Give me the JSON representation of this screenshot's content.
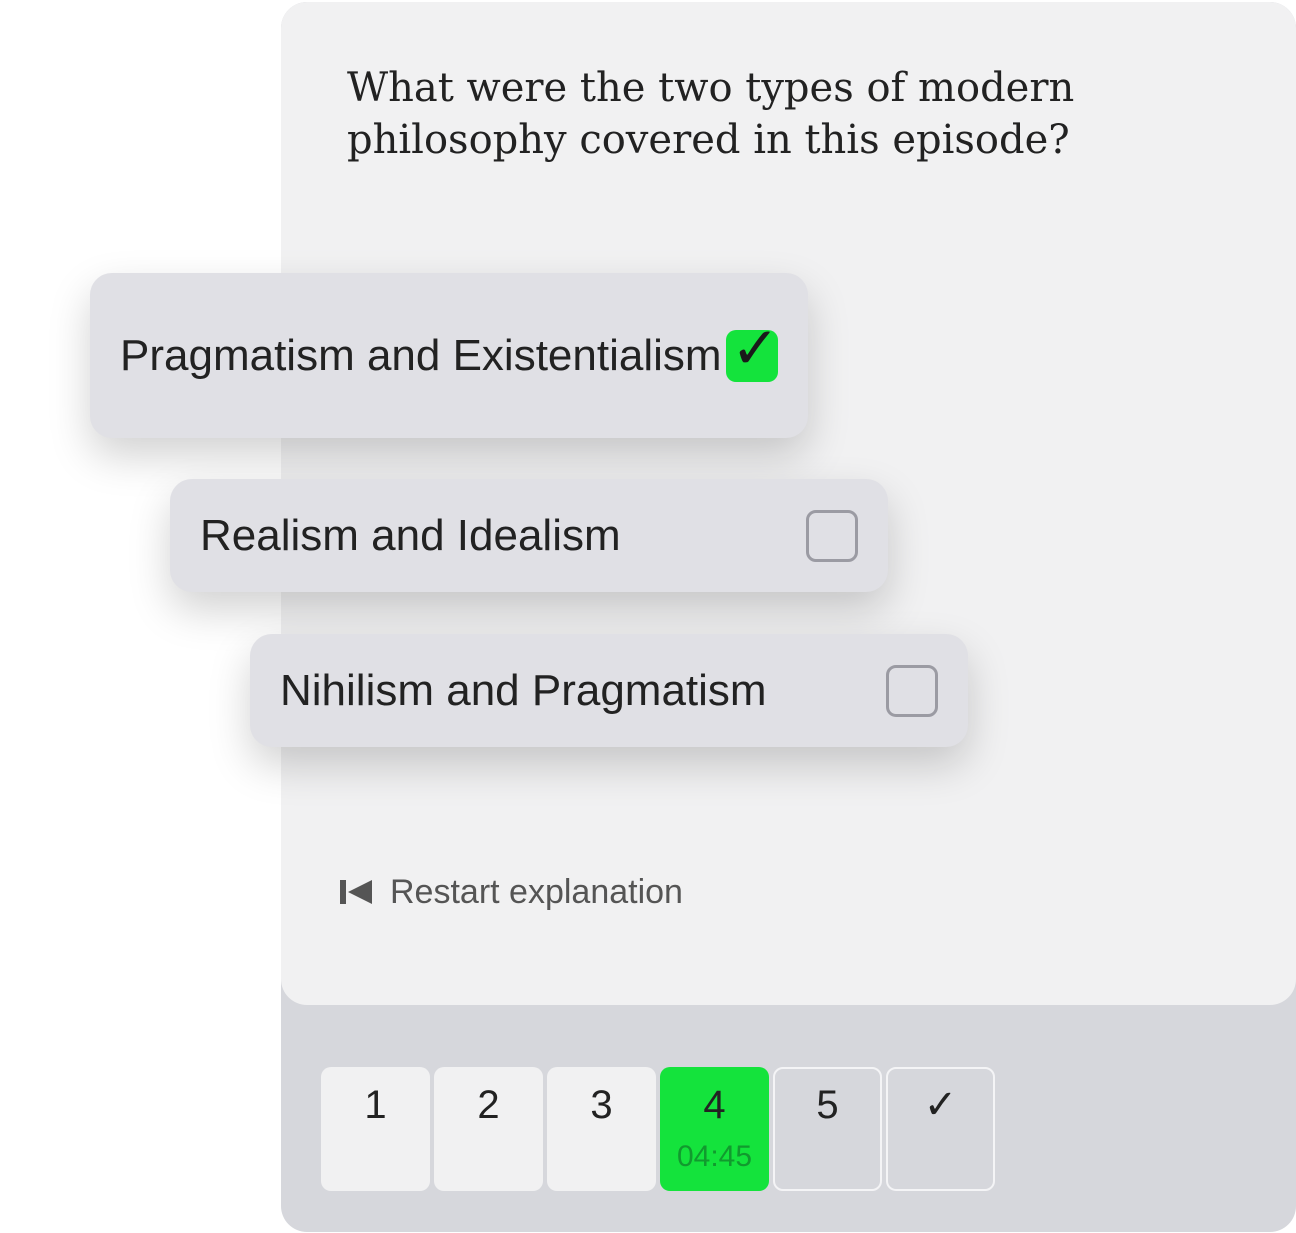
{
  "quiz": {
    "question": "What were the two types of modern philosophy covered in this episode?",
    "options": [
      {
        "label": "Pragmatism and Existentialism",
        "checked": true
      },
      {
        "label": "Realism and Idealism",
        "checked": false
      },
      {
        "label": "Nihilism and Pragmatism",
        "checked": false
      }
    ],
    "check_glyph": "✓",
    "restart_label": "Restart explanation",
    "restart_icon": "skip-back-icon"
  },
  "progress": {
    "steps": [
      {
        "label": "1",
        "state": "completed"
      },
      {
        "label": "2",
        "state": "completed"
      },
      {
        "label": "3",
        "state": "completed"
      },
      {
        "label": "4",
        "state": "active",
        "time": "04:45"
      },
      {
        "label": "5",
        "state": "upcoming"
      },
      {
        "label": "✓",
        "state": "upcoming"
      }
    ]
  },
  "colors": {
    "accent": "#14e33c",
    "card_top": "#f1f1f2",
    "card_bottom": "#d6d7dc",
    "option_bg": "#e0e0e5"
  }
}
